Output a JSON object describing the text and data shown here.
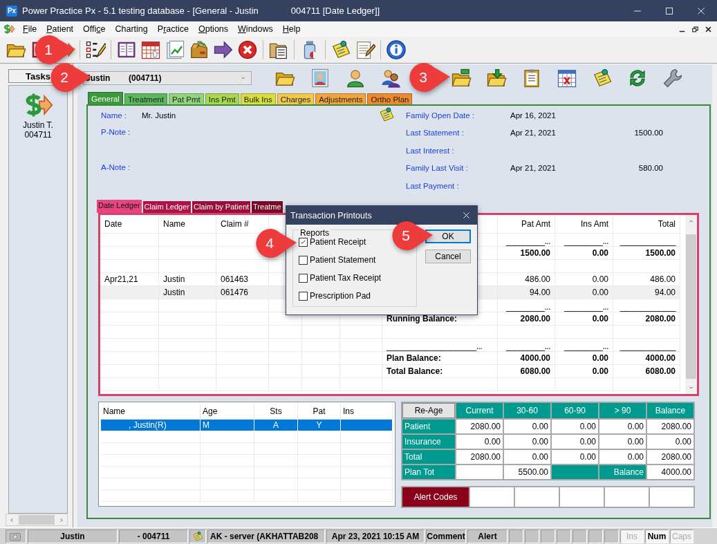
{
  "window": {
    "logo": "Px",
    "title": "Power Practice Px - 5.1 testing database - [General - Justin             004711 [Date Ledger]]"
  },
  "menu": [
    {
      "label": [
        {
          "text": "F",
          "underlined": true
        },
        {
          "text": "ile",
          "underlined": false
        }
      ]
    },
    {
      "label": [
        {
          "text": "P",
          "underlined": true
        },
        {
          "text": "atient",
          "underlined": false
        }
      ]
    },
    {
      "label": [
        {
          "text": "Offi",
          "underlined": false
        },
        {
          "text": "c",
          "underlined": true
        },
        {
          "text": "e",
          "underlined": false
        }
      ]
    },
    {
      "label": [
        {
          "text": "Charting",
          "underlined": false
        }
      ]
    },
    {
      "label": [
        {
          "text": "P",
          "underlined": false
        },
        {
          "text": "r",
          "underlined": true
        },
        {
          "text": "actice",
          "underlined": false
        }
      ]
    },
    {
      "label": [
        {
          "text": "O",
          "underlined": true
        },
        {
          "text": "ptions",
          "underlined": false
        }
      ]
    },
    {
      "label": [
        {
          "text": "W",
          "underlined": true
        },
        {
          "text": "indows",
          "underlined": false
        }
      ]
    },
    {
      "label": [
        {
          "text": "H",
          "underlined": true
        },
        {
          "text": "elp",
          "underlined": false
        }
      ]
    }
  ],
  "tasks": {
    "label": "Tasks",
    "items": [
      {
        "name": "Justin T.",
        "id": "004711"
      }
    ]
  },
  "patient_selector": {
    "name": "Justin",
    "id": "(004711)"
  },
  "tabs": [
    {
      "label": "General",
      "selected": true,
      "color": "#3c9a3c"
    },
    {
      "label": "Treatment",
      "selected": false,
      "color": "#5cb85c"
    },
    {
      "label": "Pat Pmt",
      "selected": false,
      "color": "#92d47c"
    },
    {
      "label": "Ins Pmt",
      "selected": false,
      "color": "#a8d84c"
    },
    {
      "label": "Bulk Ins",
      "selected": false,
      "color": "#dcdc3c"
    },
    {
      "label": "Charges",
      "selected": false,
      "color": "#f2c84c"
    },
    {
      "label": "Adjustments",
      "selected": false,
      "color": "#f3a53c"
    },
    {
      "label": "Ortho Plan",
      "selected": false,
      "color": "#ee8a2c"
    }
  ],
  "info": {
    "left": [
      {
        "label": "Name :",
        "value": "Mr. Justin",
        "kind": "line"
      },
      {
        "label": "P-Note :",
        "kind": "note"
      },
      {
        "label": "A-Note :",
        "kind": "note"
      }
    ],
    "right": [
      {
        "label": "Family Open Date :",
        "date": "Apr 16, 2021"
      },
      {
        "label": "Last Statement :",
        "date": "Apr 21, 2021",
        "amount": "1500.00"
      },
      {
        "label": "Last Interest :"
      },
      {
        "label": "Family Last Visit :",
        "date": "Apr 21, 2021",
        "amount": "580.00"
      },
      {
        "label": "Last Payment :"
      }
    ]
  },
  "ledger": {
    "tabs": [
      {
        "label": "Date Ledger",
        "selected": true,
        "color": "#e8457e"
      },
      {
        "label": "Claim Ledger",
        "selected": false,
        "color": "#b01248"
      },
      {
        "label": "Claim by Patient",
        "selected": false,
        "color": "#9c0e3a"
      },
      {
        "label": "Treatme",
        "selected": false,
        "color": "#780a28"
      }
    ],
    "columns": [
      "Date",
      "Name",
      "Claim #",
      null,
      null,
      null,
      null,
      "Pat Amt",
      "Ins Amt",
      "Total"
    ],
    "rows": [
      {
        "kind": "rule",
        "selected": false,
        "cells": [
          null,
          null,
          null,
          null,
          null,
          null,
          null,
          "_________...",
          "_________...",
          "_____________"
        ]
      },
      {
        "kind": "sum",
        "selected": false,
        "cells": [
          null,
          null,
          null,
          null,
          null,
          null,
          null,
          "1500.00",
          "0.00",
          "1500.00"
        ]
      },
      {
        "kind": "blank",
        "selected": false
      },
      {
        "kind": "entry",
        "selected": false,
        "cells": [
          "Apr21,21",
          "Justin",
          "061463",
          null,
          null,
          null,
          null,
          "486.00",
          "0.00",
          "486.00"
        ]
      },
      {
        "kind": "entry",
        "selected": true,
        "cells": [
          null,
          "Justin",
          "061476",
          null,
          null,
          null,
          null,
          "94.00",
          "0.00",
          "94.00"
        ]
      },
      {
        "kind": "rule",
        "selected": false,
        "cells": [
          null,
          null,
          null,
          null,
          null,
          null,
          null,
          "_________...",
          "_________...",
          "_____________"
        ]
      },
      {
        "kind": "sum",
        "selected": false,
        "cells": [
          null,
          null,
          null,
          null,
          null,
          null,
          "Running Balance:",
          "2080.00",
          "0.00",
          "2080.00"
        ]
      },
      {
        "kind": "blank",
        "selected": false
      },
      {
        "kind": "rule",
        "selected": false,
        "cells": [
          null,
          null,
          null,
          null,
          null,
          null,
          "_____________________...",
          "_________...",
          "_________...",
          "_____________"
        ]
      },
      {
        "kind": "sum",
        "selected": false,
        "cells": [
          null,
          null,
          null,
          null,
          null,
          null,
          "Plan Balance:",
          "4000.00",
          "0.00",
          "4000.00"
        ]
      },
      {
        "kind": "sum",
        "selected": false,
        "cells": [
          null,
          null,
          null,
          null,
          null,
          null,
          "Total Balance:",
          "6080.00",
          "0.00",
          "6080.00"
        ]
      },
      {
        "kind": "blank",
        "selected": false
      }
    ]
  },
  "dialog": {
    "title": "Transaction Printouts",
    "group": "Reports",
    "options": [
      {
        "label": "Patient Receipt",
        "checked": true
      },
      {
        "label": "Patient Statement",
        "checked": false
      },
      {
        "label": "Patient Tax Receipt",
        "checked": false
      },
      {
        "label": "Prescription Pad",
        "checked": false
      }
    ],
    "buttons": [
      {
        "label": "OK",
        "default": true
      },
      {
        "label": "Cancel",
        "default": false
      }
    ]
  },
  "family": {
    "columns": [
      "Name",
      "Age",
      "Sts",
      "Pat",
      "Ins"
    ],
    "rows": [
      {
        "cells": [
          ", Justin(R)",
          "M",
          "A",
          "Y"
        ],
        "selected": true
      }
    ]
  },
  "aging": {
    "reage": "Re-Age",
    "columns": [
      "Current",
      "30-60",
      "60-90",
      "> 90",
      "Balance"
    ],
    "rows": [
      {
        "label": "Patient",
        "cells": [
          {
            "kind": "value",
            "text": "2080.00"
          },
          {
            "kind": "value",
            "text": "0.00"
          },
          {
            "kind": "value",
            "text": "0.00"
          },
          {
            "kind": "value",
            "text": "0.00"
          },
          {
            "kind": "value",
            "text": "2080.00"
          }
        ]
      },
      {
        "label": "Insurance",
        "cells": [
          {
            "kind": "value",
            "text": "0.00"
          },
          {
            "kind": "value",
            "text": "0.00"
          },
          {
            "kind": "value",
            "text": "0.00"
          },
          {
            "kind": "value",
            "text": "0.00"
          },
          {
            "kind": "value",
            "text": "0.00"
          }
        ]
      },
      {
        "label": "Total",
        "cells": [
          {
            "kind": "value",
            "text": "2080.00"
          },
          {
            "kind": "value",
            "text": "0.00"
          },
          {
            "kind": "value",
            "text": "0.00"
          },
          {
            "kind": "value",
            "text": "0.00"
          },
          {
            "kind": "value",
            "text": "2080.00"
          }
        ]
      },
      {
        "label": "Plan Tot",
        "cells": [
          {
            "kind": "value"
          },
          {
            "kind": "value",
            "text": "5500.00"
          },
          {
            "kind": "label"
          },
          {
            "kind": "label",
            "text": "Balance"
          },
          {
            "kind": "value",
            "text": "4000.00"
          }
        ]
      }
    ],
    "alert_codes": "Alert Codes"
  },
  "status_bar": {
    "patient": "Justin",
    "id": "- 004711",
    "server": "AK - server (AKHATTAB208",
    "datetime": "Apr 23, 2021 10:15 AM",
    "comment": "Comment",
    "alert": "Alert",
    "keys": [
      {
        "label": "Ins",
        "on": false
      },
      {
        "label": "Num",
        "on": true
      },
      {
        "label": "Caps",
        "on": false
      }
    ]
  },
  "callouts": [
    {
      "number": "1"
    },
    {
      "number": "2"
    },
    {
      "number": "3"
    },
    {
      "number": "4"
    },
    {
      "number": "5"
    }
  ]
}
